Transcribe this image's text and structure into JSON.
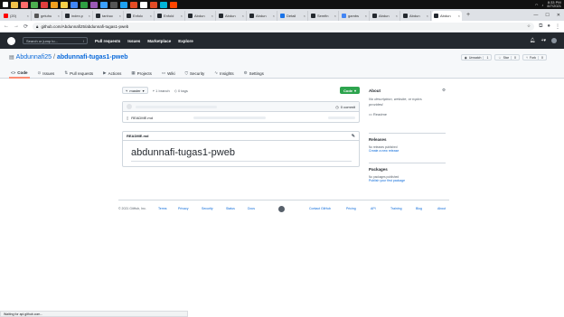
{
  "taskbar": {
    "apps": [
      {
        "icon": "windows-icon",
        "color": "#ffffff"
      },
      {
        "icon": "files-icon",
        "color": "#f0c24b"
      },
      {
        "icon": "app-icon",
        "color": "#ff6b6b"
      },
      {
        "icon": "app-icon",
        "color": "#4caf50"
      },
      {
        "icon": "app-icon",
        "color": "#e03e3e"
      },
      {
        "icon": "app-icon",
        "color": "#f0a020"
      },
      {
        "icon": "folder-icon",
        "color": "#f5d04a"
      },
      {
        "icon": "chrome-icon",
        "color": "#4285f4"
      },
      {
        "icon": "app-icon",
        "color": "#2ea043"
      },
      {
        "icon": "app-icon",
        "color": "#9b59b6"
      },
      {
        "icon": "vscode-icon",
        "color": "#3ba0ff"
      },
      {
        "icon": "app-icon",
        "color": "#555555"
      },
      {
        "icon": "app-icon",
        "color": "#1da1f2"
      },
      {
        "icon": "app-icon",
        "color": "#e44d26"
      },
      {
        "icon": "app-icon",
        "color": "#ffffff"
      },
      {
        "icon": "app-icon",
        "color": "#e34c26"
      },
      {
        "icon": "app-icon",
        "color": "#00b4d8"
      },
      {
        "icon": "app-icon",
        "color": "#ff4500"
      }
    ],
    "clock_time": "8:33 PM",
    "clock_date": "8/7/2021"
  },
  "browser": {
    "tabs": [
      {
        "label": "(20)",
        "color": "#ff0000"
      },
      {
        "label": "getuhu",
        "color": "#555555"
      },
      {
        "label": "index.p",
        "color": "#24292f"
      },
      {
        "label": "tanhuc",
        "color": "#24292f"
      },
      {
        "label": "Enfolc",
        "color": "#24292f"
      },
      {
        "label": "Enfold",
        "color": "#24292f"
      },
      {
        "label": "Abdun",
        "color": "#24292f"
      },
      {
        "label": "Abdun",
        "color": "#24292f"
      },
      {
        "label": "Abdun",
        "color": "#24292f"
      },
      {
        "label": "Detail",
        "color": "#1a73e8"
      },
      {
        "label": "Semfin",
        "color": "#24292f"
      },
      {
        "label": "gambs",
        "color": "#4285f4"
      },
      {
        "label": "Abdun",
        "color": "#24292f"
      },
      {
        "label": "Abdun",
        "color": "#24292f"
      },
      {
        "label": "Abdun",
        "color": "#24292f",
        "active": true
      }
    ],
    "url": "github.com/Abdunnafi25/abdunnafi-tugas1-pweb"
  },
  "github": {
    "search_placeholder": "Search or jump to...",
    "search_key": "/",
    "nav": [
      "Pull requests",
      "Issues",
      "Marketplace",
      "Explore"
    ],
    "owner": "Abdunnafi25",
    "separator": "/",
    "repo": "abdunnafi-tugas1-pweb",
    "actions": {
      "unwatch": "Unwatch",
      "unwatch_count": "1",
      "star": "Star",
      "star_count": "0",
      "fork": "Fork",
      "fork_count": "0"
    },
    "tabs": [
      {
        "label": "Code",
        "icon": "code-icon",
        "selected": true
      },
      {
        "label": "Issues",
        "icon": "issue-icon"
      },
      {
        "label": "Pull requests",
        "icon": "pull-request-icon"
      },
      {
        "label": "Actions",
        "icon": "actions-icon"
      },
      {
        "label": "Projects",
        "icon": "projects-icon"
      },
      {
        "label": "Wiki",
        "icon": "wiki-icon"
      },
      {
        "label": "Security",
        "icon": "shield-icon"
      },
      {
        "label": "Insights",
        "icon": "graph-icon"
      },
      {
        "label": "Settings",
        "icon": "gear-icon"
      }
    ],
    "branch": "master",
    "branch_count": "1 branch",
    "tag_count": "0 tags",
    "code_button": "Code",
    "commit_count": "0 commit",
    "files": [
      {
        "name": "README.md"
      }
    ],
    "readme_label": "README.md",
    "readme_heading": "abdunnafi-tugas1-pweb",
    "about": {
      "title": "About",
      "description": "No description, website, or topics provided.",
      "readme_link": "Readme"
    },
    "releases": {
      "title": "Releases",
      "none": "No releases published",
      "create": "Create a new release"
    },
    "packages": {
      "title": "Packages",
      "none": "No packages published",
      "publish": "Publish your first package"
    },
    "footer": {
      "copyright": "© 2021 GitHub, Inc.",
      "links_left": [
        "Terms",
        "Privacy",
        "Security",
        "Status",
        "Docs"
      ],
      "links_right": [
        "Contact GitHub",
        "Pricing",
        "API",
        "Training",
        "Blog",
        "About"
      ]
    }
  },
  "status": "Waiting for api.github.com..."
}
